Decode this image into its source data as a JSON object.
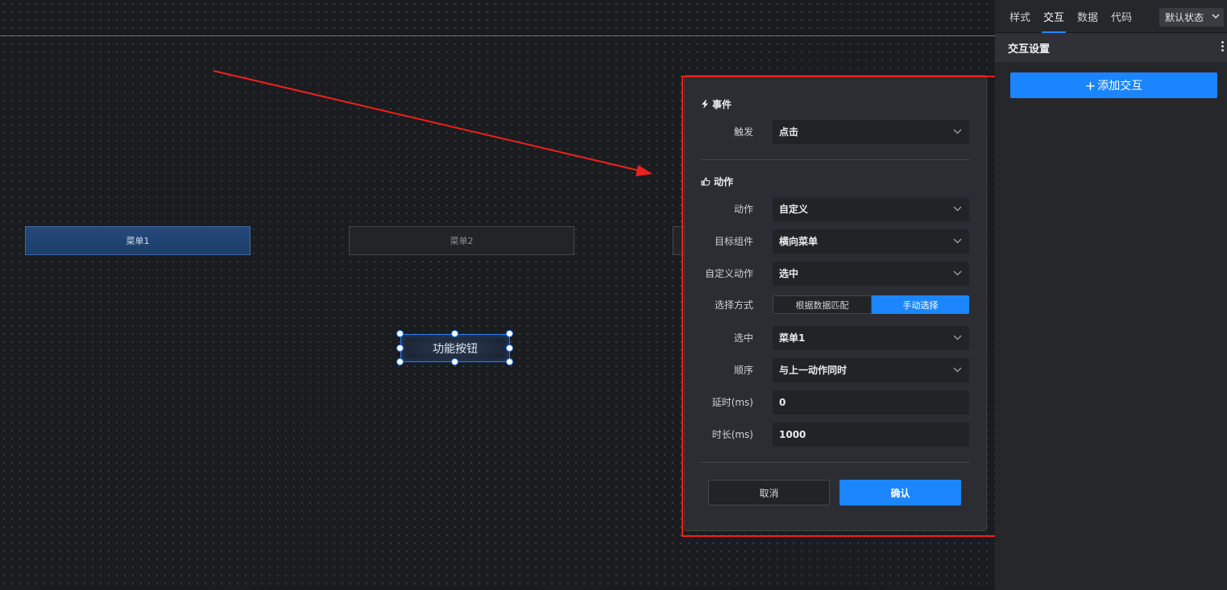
{
  "canvas": {
    "menu_items": [
      "菜单1",
      "菜单2"
    ],
    "function_button_label": "功能按钮"
  },
  "panel": {
    "tabs": [
      "样式",
      "交互",
      "数据",
      "代码"
    ],
    "active_tab": "交互",
    "state_select": "默认状态",
    "section_title": "交互设置",
    "add_button": "添加交互"
  },
  "dialog": {
    "event_title": "事件",
    "trigger_label": "触发",
    "trigger_value": "点击",
    "action_title": "动作",
    "fields": {
      "action": {
        "label": "动作",
        "value": "自定义"
      },
      "target": {
        "label": "目标组件",
        "value": "横向菜单"
      },
      "custom_action": {
        "label": "自定义动作",
        "value": "选中"
      },
      "select_mode": {
        "label": "选择方式",
        "options": [
          "根据数据匹配",
          "手动选择"
        ],
        "selected": "手动选择"
      },
      "selected": {
        "label": "选中",
        "value": "菜单1"
      },
      "order": {
        "label": "顺序",
        "value": "与上一动作同时"
      },
      "delay": {
        "label": "延时(ms)",
        "value": "0"
      },
      "duration": {
        "label": "时长(ms)",
        "value": "1000"
      }
    },
    "cancel_label": "取消",
    "confirm_label": "确认"
  },
  "colors": {
    "accent": "#1b86ff",
    "annotation_red": "#f0211b",
    "canvas_bg": "#1b1c1f",
    "panel_bg": "#26272b"
  }
}
